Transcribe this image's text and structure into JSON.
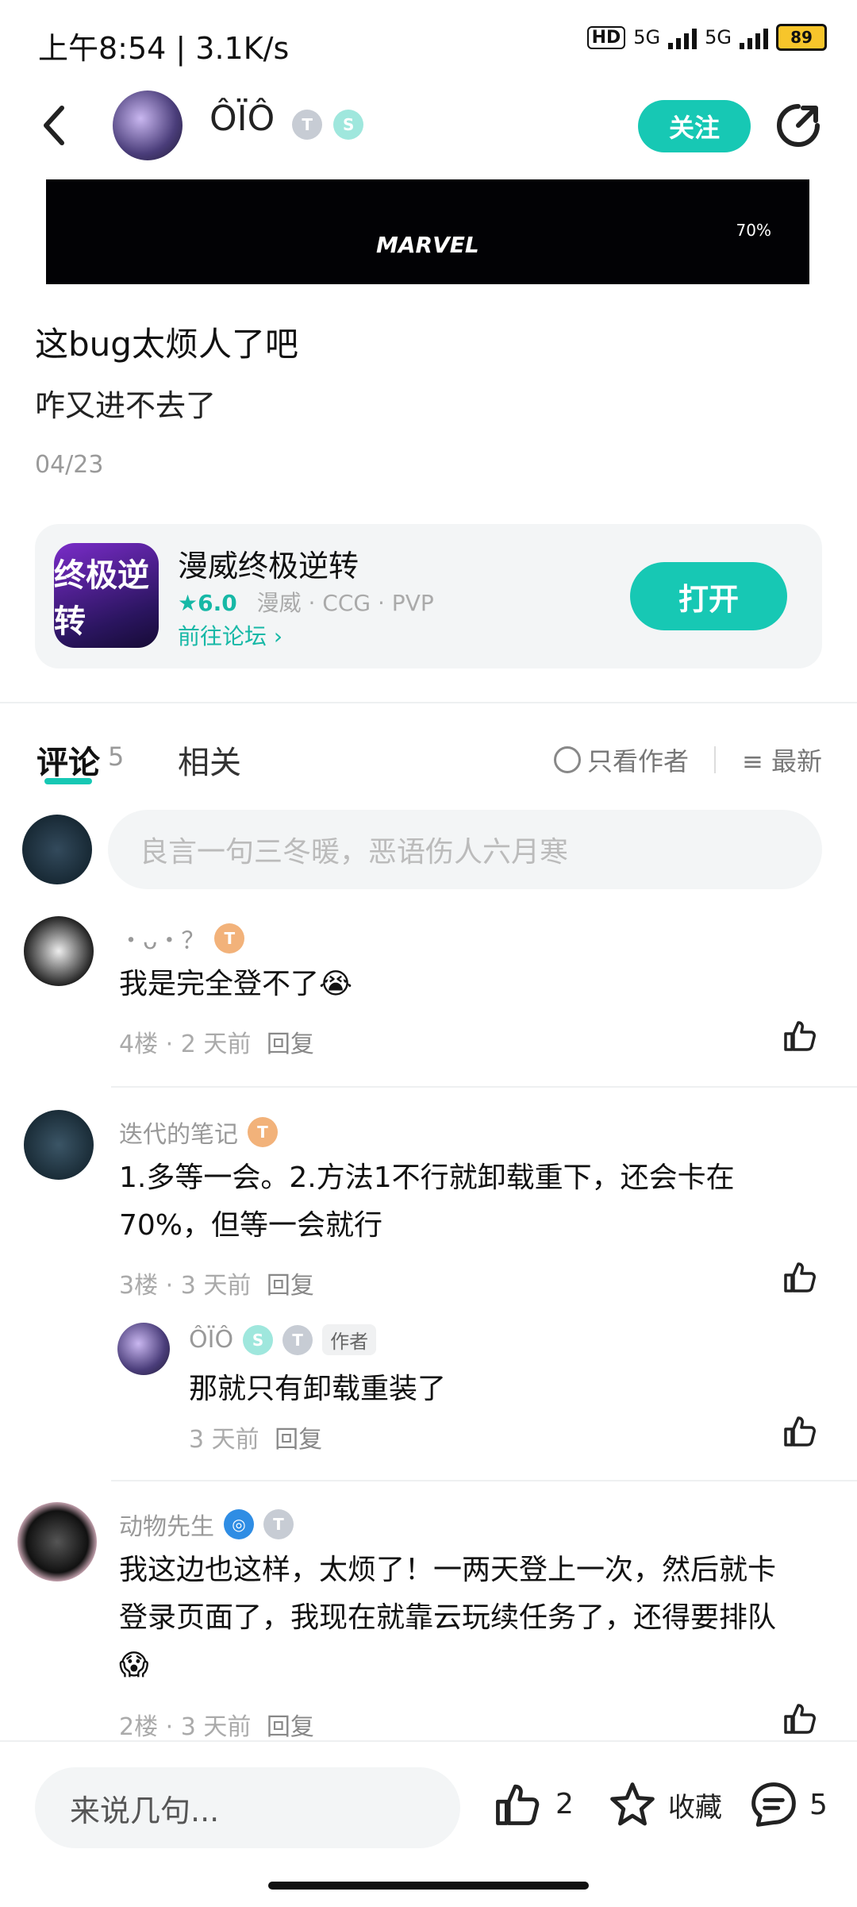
{
  "status": {
    "time": "上午8:54 | 3.1K/s",
    "hd": "HD",
    "net1": "5G",
    "net2": "5G",
    "battery": "89"
  },
  "header": {
    "username": "ÔÏÔ",
    "badge_level": "T",
    "follow_label": "关注"
  },
  "banner": {
    "logo_text": "MARVEL",
    "progress": "70%"
  },
  "post": {
    "title": "这bug太烦人了吧",
    "body": "咋又进不去了",
    "date": "04/23"
  },
  "game": {
    "icon_text": "终极逆转",
    "name": "漫威终极逆转",
    "score": "★6.0",
    "tags": "漫威 · CCG · PVP",
    "forum_link": "前往论坛 ›",
    "open_label": "打开"
  },
  "tabs": {
    "comment": "评论",
    "comment_count": "5",
    "related": "相关",
    "only_author": "只看作者",
    "sort": "最新"
  },
  "input": {
    "placeholder": "良言一句三冬暖，恶语伤人六月寒"
  },
  "comments": [
    {
      "name": "・ᴗ・？",
      "text": "我是完全登不了😭",
      "floor": "4楼 · 2 天前",
      "reply": "回复"
    },
    {
      "name": "迭代的笔记",
      "text": "1.多等一会。2.方法1不行就卸载重下，还会卡在70%，但等一会就行",
      "floor": "3楼 · 3 天前",
      "reply": "回复",
      "sub": {
        "name": "ÔÏÔ",
        "tag": "作者",
        "text": "那就只有卸载重装了",
        "time": "3 天前",
        "reply": "回复"
      }
    },
    {
      "name": "动物先生",
      "text": "我这边也这样，太烦了！一两天登上一次，然后就卡登录页面了，我现在就靠云玩续任务了，还得要排队😱",
      "floor": "2楼 · 3 天前",
      "reply": "回复"
    }
  ],
  "bottom": {
    "say_placeholder": "来说几句...",
    "like_count": "2",
    "fav_label": "收藏",
    "comment_count": "5"
  }
}
